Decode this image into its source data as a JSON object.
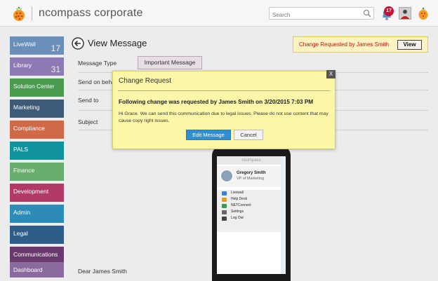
{
  "header": {
    "brand": "ncompass corporate",
    "search_placeholder": "Search",
    "notification_count": "17"
  },
  "sidebar": {
    "items": [
      {
        "label": "LiveWall",
        "count": "17",
        "color": "#6a8fb8"
      },
      {
        "label": "Library",
        "count": "31",
        "color": "#8d79b3"
      },
      {
        "label": "Solution Center",
        "count": "",
        "color": "#4a9a50"
      },
      {
        "label": "Marketing",
        "count": "",
        "color": "#3d5b78"
      },
      {
        "label": "Compliance",
        "count": "",
        "color": "#cf6a49"
      },
      {
        "label": "PALS",
        "count": "",
        "color": "#10939b"
      },
      {
        "label": "Finance",
        "count": "",
        "color": "#66ad6e"
      },
      {
        "label": "Development",
        "count": "",
        "color": "#b13a66"
      },
      {
        "label": "Admin",
        "count": "",
        "color": "#2e8bb8"
      },
      {
        "label": "Legal",
        "count": "",
        "color": "#2f5d8a"
      },
      {
        "label": "Communications",
        "count": "",
        "color": "#6a3a6e"
      },
      {
        "label": "Dashboard",
        "count": "",
        "color": "#8b6aa0"
      }
    ]
  },
  "main": {
    "title": "View Message",
    "banner_text": "Change Requested by James Smith",
    "banner_button": "View",
    "fields": {
      "message_type_label": "Message Type",
      "message_type_value": "Important Message",
      "send_on_behalf_label": "Send on behalf",
      "send_to_label": "Send to",
      "subject_label": "Subject"
    },
    "greeting": "Dear James Smith"
  },
  "phone": {
    "app_title": "ncompass",
    "profile_name": "Gregory Smith",
    "profile_role": "VP of Marketing",
    "menu": [
      {
        "label": "Livewall",
        "color": "#3f7fcf"
      },
      {
        "label": "Help Desk",
        "color": "#e19d2b"
      },
      {
        "label": "NETConnect",
        "color": "#3c9a44"
      },
      {
        "label": "Settings",
        "color": "#666666"
      },
      {
        "label": "Log Out",
        "color": "#444444"
      }
    ]
  },
  "dialog": {
    "title": "Change Request",
    "close": "X",
    "heading": "Following change was requested by James Smith on 3/20/2015 7:03 PM",
    "body": "Hi Grace. We can send this communication due to legal issues. Please do not use content that may cause copy right issues.",
    "edit_button": "Edit Message",
    "cancel_button": "Cancel"
  }
}
